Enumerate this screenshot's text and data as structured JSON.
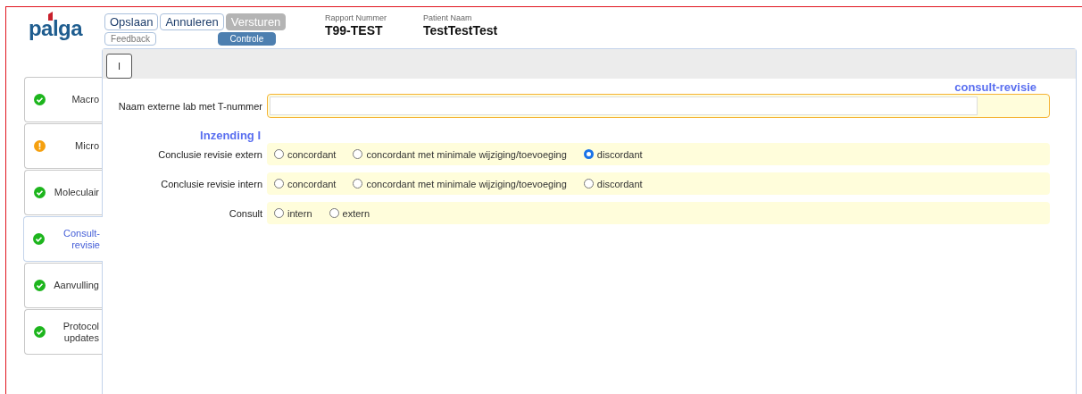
{
  "logo": {
    "text": "palga"
  },
  "toolbar": {
    "buttons": [
      {
        "label": "Opslaan",
        "disabled": false
      },
      {
        "label": "Annuleren",
        "disabled": false
      },
      {
        "label": "Versturen",
        "disabled": true
      }
    ],
    "sub_buttons": [
      {
        "label": "Feedback",
        "kind": "outline"
      },
      {
        "label": "Controle",
        "kind": "filled"
      }
    ]
  },
  "header_fields": [
    {
      "label": "Rapport Nummer",
      "value": "T99-TEST"
    },
    {
      "label": "Patient Naam",
      "value": "TestTestTest"
    }
  ],
  "sidebar": {
    "items": [
      {
        "label": "Macro",
        "warning": false,
        "selected": false
      },
      {
        "label": "Micro",
        "warning": true,
        "selected": false
      },
      {
        "label": "Moleculair",
        "warning": false,
        "selected": false
      },
      {
        "label": "Consult-\nrevisie",
        "warning": false,
        "selected": true
      },
      {
        "label": "Aanvulling",
        "warning": false,
        "selected": false
      },
      {
        "label": "Protocol\nupdates",
        "warning": false,
        "selected": false
      }
    ]
  },
  "panel": {
    "tabs": [
      {
        "label": "I",
        "selected": true
      }
    ],
    "section_title": "consult-revisie",
    "text_field": {
      "label": "Naam externe lab met T-nummer"
    },
    "group_title": "Inzending I",
    "radio_groups": [
      {
        "label": "Conclusie revisie extern",
        "options": [
          {
            "label": "concordant",
            "selected": false
          },
          {
            "label": "concordant met minimale wijziging/toevoeging",
            "selected": false
          },
          {
            "label": "discordant",
            "selected": true
          }
        ]
      },
      {
        "label": "Conclusie revisie intern",
        "options": [
          {
            "label": "concordant",
            "selected": false
          },
          {
            "label": "concordant met minimale wijziging/toevoeging",
            "selected": false
          },
          {
            "label": "discordant",
            "selected": false
          }
        ]
      },
      {
        "label": "Consult",
        "options": [
          {
            "label": "intern",
            "selected": false
          },
          {
            "label": "extern",
            "selected": false
          }
        ]
      }
    ]
  }
}
